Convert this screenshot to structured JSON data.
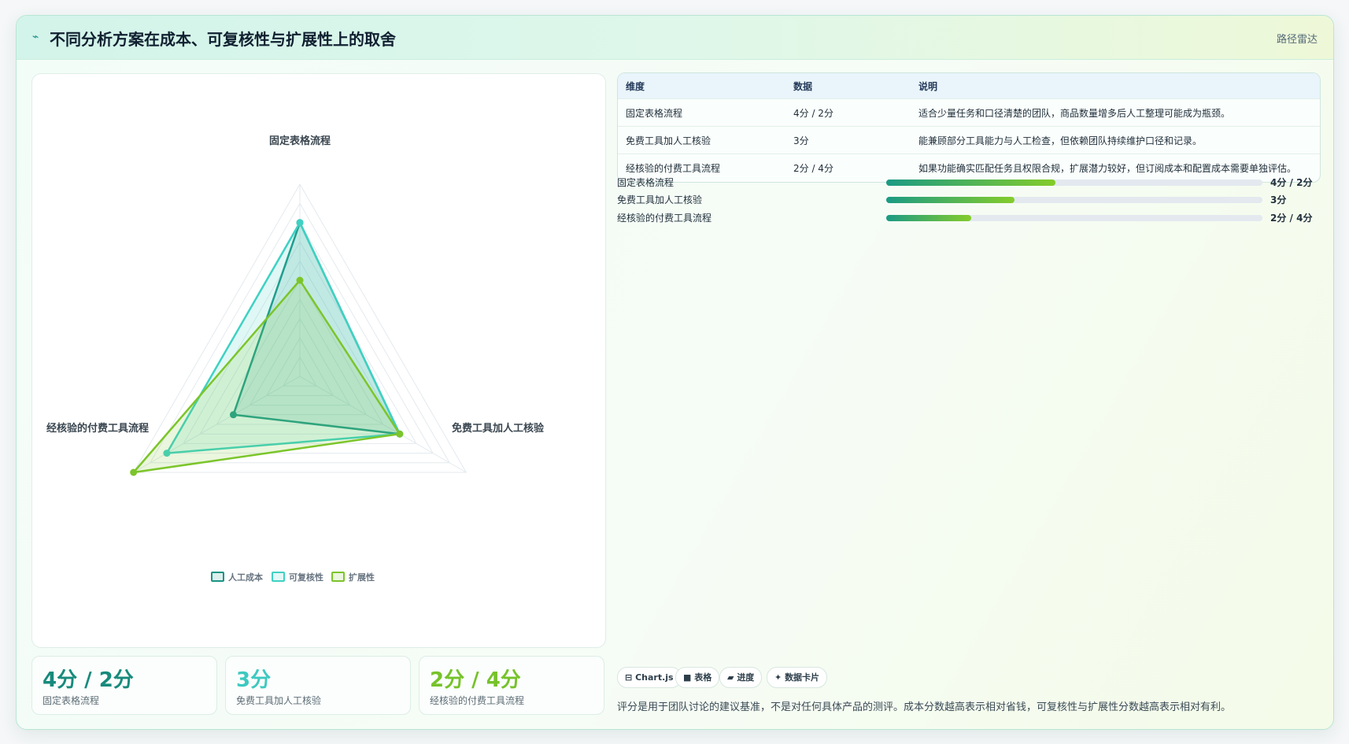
{
  "header": {
    "icon": "pulse-icon",
    "title": "不同分析方案在成本、可复核性与扩展性上的取舍",
    "badge": "路径雷达"
  },
  "chart_data": {
    "type": "radar",
    "axes": [
      "固定表格流程",
      "免费工具加人工核验",
      "经核验的付费工具流程"
    ],
    "range": [
      0,
      5
    ],
    "series": [
      {
        "name": "人工成本",
        "values": [
          4,
          3,
          2
        ],
        "color": "#1a9483"
      },
      {
        "name": "可复核性",
        "values": [
          4,
          3,
          4
        ],
        "color": "#3fd1c3"
      },
      {
        "name": "扩展性",
        "values": [
          2.5,
          3,
          5
        ],
        "color": "#7cc52a"
      }
    ],
    "legend_position": "bottom"
  },
  "kpis": [
    {
      "value": "4分 / 2分",
      "label": "固定表格流程",
      "color": "#178a7c"
    },
    {
      "value": "3分",
      "label": "免费工具加人工核验",
      "color": "#3ec9c0"
    },
    {
      "value": "2分 / 4分",
      "label": "经核验的付费工具流程",
      "color": "#76c22a"
    }
  ],
  "table": {
    "headers": [
      "维度",
      "数据",
      "说明"
    ],
    "rows": [
      [
        "固定表格流程",
        "4分 / 2分",
        "适合少量任务和口径清楚的团队，商品数量增多后人工整理可能成为瓶颈。"
      ],
      [
        "免费工具加人工核验",
        "3分",
        "能兼顾部分工具能力与人工检查，但依赖团队持续维护口径和记录。"
      ],
      [
        "经核验的付费工具流程",
        "2分 / 4分",
        "如果功能确实匹配任务且权限合规，扩展潜力较好，但订阅成本和配置成本需要单独评估。"
      ]
    ]
  },
  "bars": [
    {
      "label": "固定表格流程",
      "value": "4分 / 2分",
      "fill": 0.45
    },
    {
      "label": "免费工具加人工核验",
      "value": "3分",
      "fill": 0.34
    },
    {
      "label": "经核验的付费工具流程",
      "value": "2分 / 4分",
      "fill": 0.225
    }
  ],
  "chips": [
    {
      "icon": "⊟",
      "label": "Chart.js"
    },
    {
      "icon": "■",
      "label": "表格"
    },
    {
      "icon": "▰",
      "label": "进度"
    },
    {
      "icon": "✦",
      "label": "数据卡片"
    }
  ],
  "footnote": "评分是用于团队讨论的建议基准，不是对任何具体产品的测评。成本分数越高表示相对省钱，可复核性与扩展性分数越高表示相对有利。"
}
